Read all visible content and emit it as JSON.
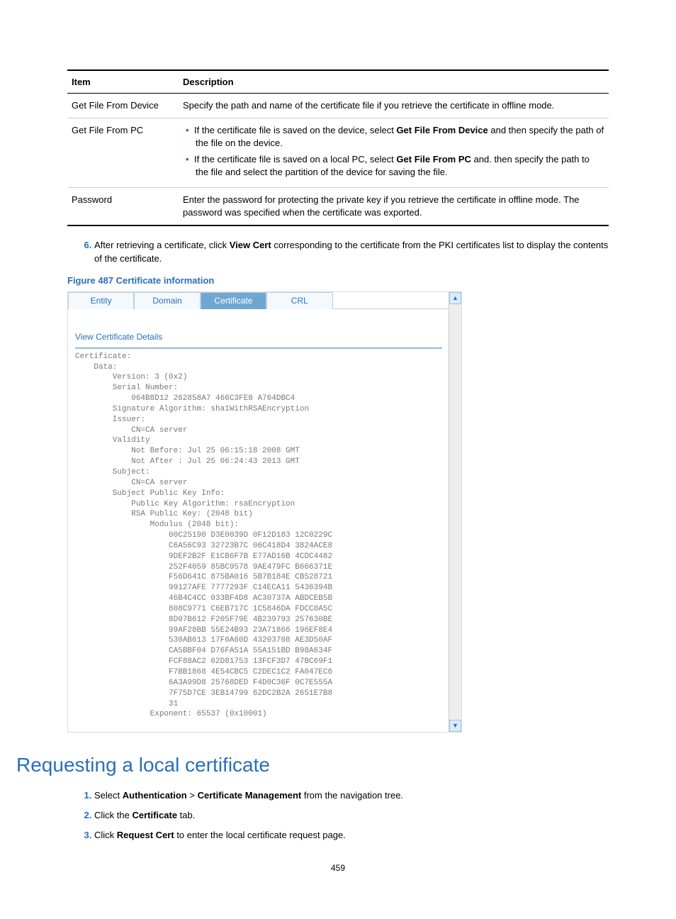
{
  "table": {
    "headers": {
      "item": "Item",
      "desc": "Description"
    },
    "rows": [
      {
        "item": "Get File From Device",
        "desc": "Specify the path and name of the certificate file if you retrieve the certificate in offline mode."
      },
      {
        "item": "Get File From PC",
        "bullets": [
          {
            "plain1": "If the certificate file is saved on the device, select ",
            "bold": "Get File From Device",
            "plain2": " and then specify the path of the file on the device."
          },
          {
            "plain1": "If the certificate file is saved on a local PC, select ",
            "bold": "Get File From PC",
            "plain2": " and. then specify the path to the file and select the partition of the device for saving the file."
          }
        ]
      },
      {
        "item": "Password",
        "desc": "Enter the password for protecting the private key if you retrieve the certificate in offline mode. The password was specified when the certificate was exported."
      }
    ]
  },
  "step6": {
    "num": "6.",
    "text1": "After retrieving a certificate, click ",
    "bold": "View Cert",
    "text2": " corresponding to the certificate from the PKI certificates list to display the contents of the certificate."
  },
  "figure_caption": "Figure 487 Certificate information",
  "ui": {
    "tabs": {
      "entity": "Entity",
      "domain": "Domain",
      "certificate": "Certificate",
      "crl": "CRL"
    },
    "view_header": "View Certificate Details",
    "scroll_up": "▲",
    "scroll_down": "▼",
    "cert_text": "Certificate:\n    Data:\n        Version: 3 (0x2)\n        Serial Number:\n            064B8D12 262858A7 466C3FE8 A764DBC4\n        Signature Algorithm: sha1WithRSAEncryption\n        Issuer:\n            CN=CA server\n        Validity\n            Not Before: Jul 25 06:15:18 2008 GMT\n            Not After : Jul 25 06:24:43 2013 GMT\n        Subject:\n            CN=CA server\n        Subject Public Key Info:\n            Public Key Algorithm: rsaEncryption\n            RSA Public Key: (2048 bit)\n                Modulus (2048 bit):\n                    00C25190 D3E0039D 0F12D183 12C0229C\n                    C6A56C93 32723B7C 06C418D4 3824ACE8\n                    9DEF2B2F E1CB6F7B E77AD16B 4CDC4482\n                    252F4059 85BC9578 9AE479FC B666371E\n                    F56D641C 875BA016 5B7B184E CB528721\n                    99127AFE 7777293F C14ECA11 5436394B\n                    46B4C4CC 033BF4D8 AC30737A ABDCEB5B\n                    808C9771 C6EB717C 1C5846DA FDCC0A5C\n                    8D07B612 F205F79E 4B239793 257630BE\n                    99AF28BB 55E24B93 23A71866 196EF8E4\n                    530AB613 17F6A60D 43203708 AE3D50AF\n                    CA5BBF04 D76FA51A 55A151BD B98A634F\n                    FCF88AC2 62D81753 13FCF3D7 47BC69F1\n                    F7BB1868 4E54CBC5 C2DEC1C2 FA047EC6\n                    6A3A99D8 25768DED F4D0C36F 0C7E555A\n                    7F75D7CE 3EB14799 62DC2B2A 2651E7B8\n                    31\n                Exponent: 65537 (0x10001)"
  },
  "section_heading": "Requesting a local certificate",
  "steps2": [
    {
      "plain1": "Select ",
      "bold1": "Authentication",
      "mid": " > ",
      "bold2": "Certificate Management",
      "plain2": " from the navigation tree."
    },
    {
      "plain1": "Click the ",
      "bold1": "Certificate",
      "plain2": " tab."
    },
    {
      "plain1": "Click ",
      "bold1": "Request Cert",
      "plain2": " to enter the local certificate request page."
    }
  ],
  "page_number": "459"
}
